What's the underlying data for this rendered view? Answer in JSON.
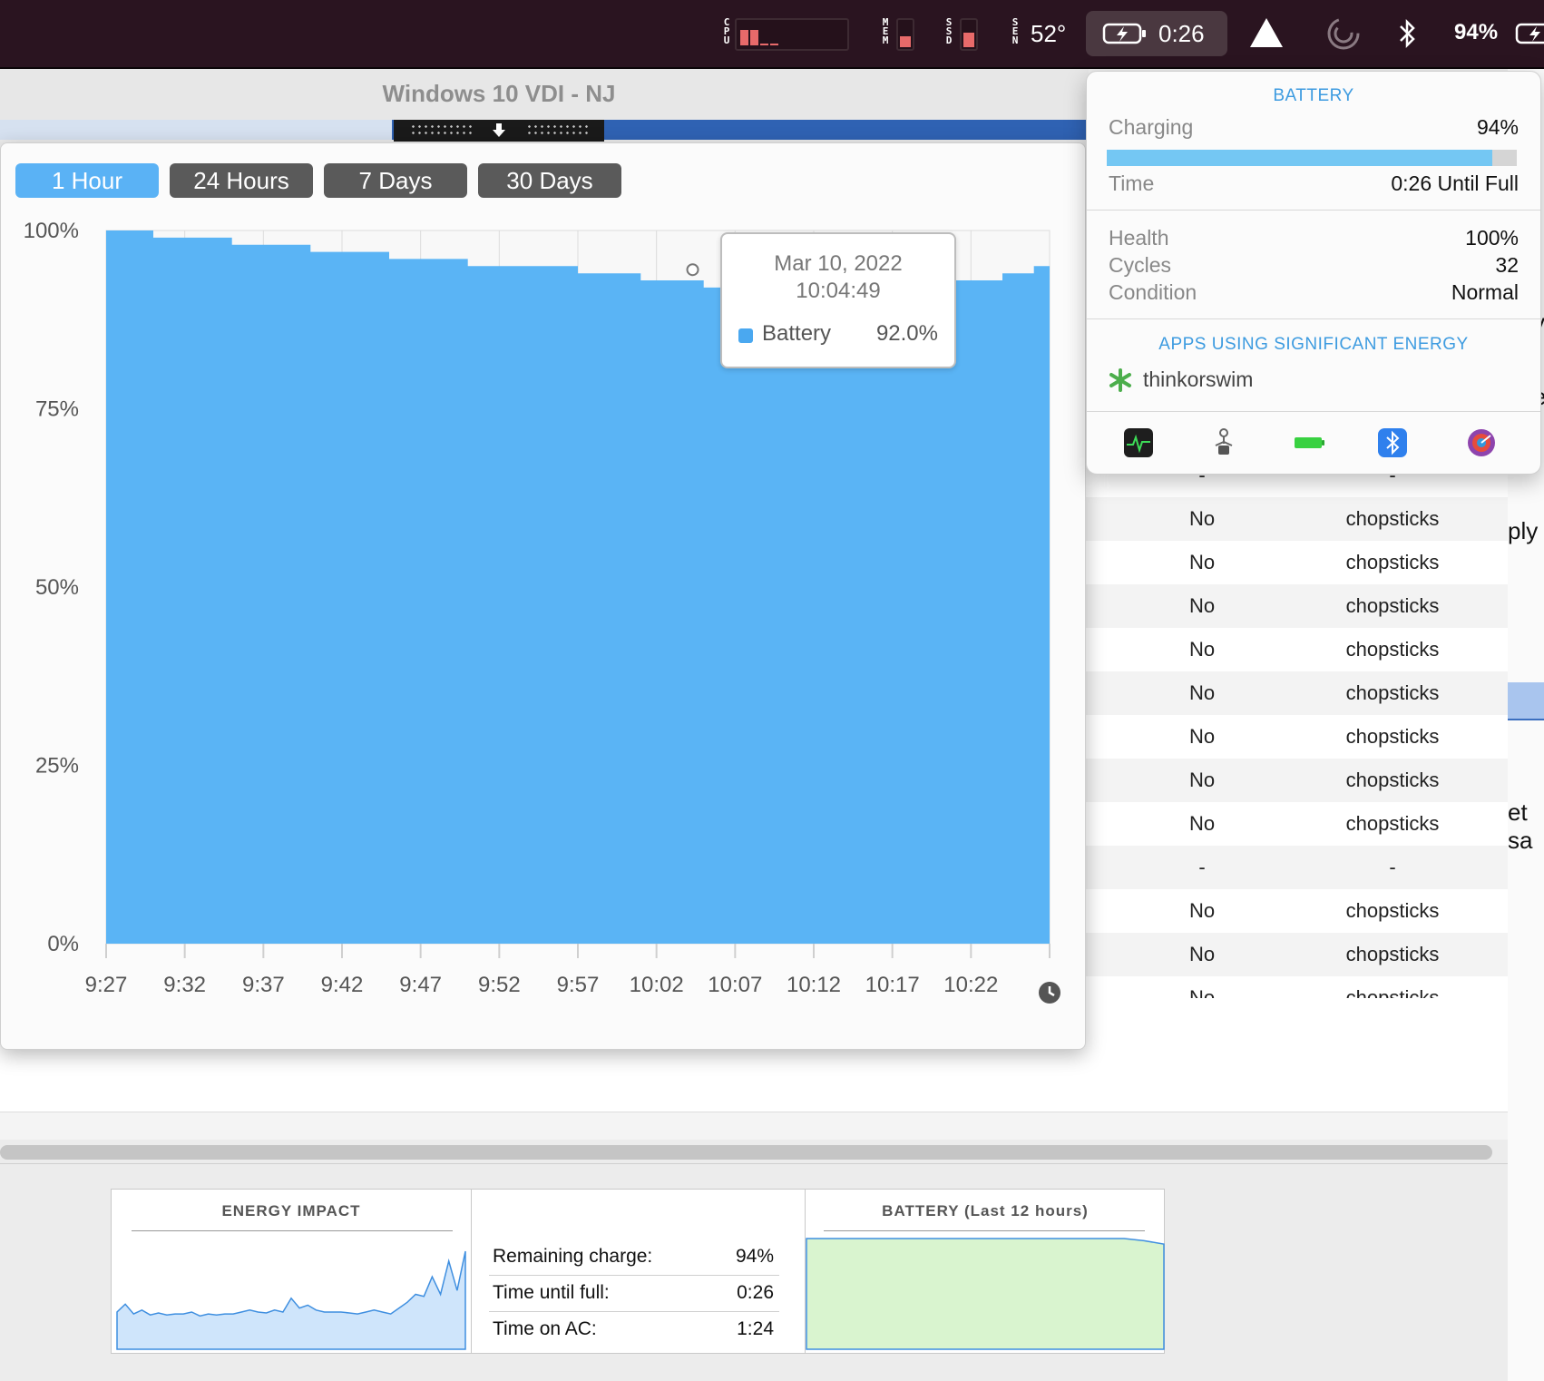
{
  "menubar": {
    "cpu_label": "CPU",
    "mem_label": "MEM",
    "ssd_label": "SSD",
    "sen_label": "SEN",
    "temperature": "52°",
    "battery_time": "0:26",
    "battery_percent": "94%",
    "cpu_bars_percent": [
      70,
      70,
      10,
      10
    ],
    "mem_fill_percent": 45,
    "ssd_fill_percent": 60,
    "icons": [
      "cpu-graph-icon",
      "battery-charging-icon",
      "warning-triangle-icon",
      "spiral-icon",
      "bluetooth-icon",
      "battery-charging-icon"
    ]
  },
  "background_window": {
    "title": "Windows 10 VDI - NJ",
    "edge_texts": [
      "ply",
      "et sa",
      "e",
      "y"
    ]
  },
  "table": {
    "rows": [
      {
        "c1": "-",
        "c2": "-"
      },
      {
        "c1": "No",
        "c2": "chopsticks"
      },
      {
        "c1": "No",
        "c2": "chopsticks"
      },
      {
        "c1": "No",
        "c2": "chopsticks"
      },
      {
        "c1": "No",
        "c2": "chopsticks"
      },
      {
        "c1": "No",
        "c2": "chopsticks"
      },
      {
        "c1": "No",
        "c2": "chopsticks"
      },
      {
        "c1": "No",
        "c2": "chopsticks"
      },
      {
        "c1": "No",
        "c2": "chopsticks"
      },
      {
        "c1": "-",
        "c2": "-"
      },
      {
        "c1": "No",
        "c2": "chopsticks"
      },
      {
        "c1": "No",
        "c2": "chopsticks"
      },
      {
        "c1": "No",
        "c2": "chopsticks"
      }
    ]
  },
  "battery_chart_window": {
    "tabs": [
      "1 Hour",
      "24 Hours",
      "7 Days",
      "30 Days"
    ],
    "active_tab": "1 Hour",
    "tooltip": {
      "date": "Mar 10, 2022",
      "time": "10:04:49",
      "series_label": "Battery",
      "value": "92.0%"
    }
  },
  "chart_data": {
    "type": "area",
    "x_tick_labels": [
      "9:27",
      "9:32",
      "9:37",
      "9:42",
      "9:47",
      "9:52",
      "9:57",
      "10:02",
      "10:07",
      "10:12",
      "10:17",
      "10:22"
    ],
    "y_tick_labels": [
      "100%",
      "75%",
      "50%",
      "25%",
      "0%"
    ],
    "ylim": [
      0,
      100
    ],
    "xlim": [
      0,
      60
    ],
    "series": [
      {
        "name": "Battery",
        "color": "#5ab4f5",
        "points": [
          [
            0,
            100
          ],
          [
            3,
            100
          ],
          [
            3,
            99
          ],
          [
            8,
            99
          ],
          [
            8,
            98
          ],
          [
            13,
            98
          ],
          [
            13,
            97
          ],
          [
            18,
            97
          ],
          [
            18,
            96
          ],
          [
            23,
            96
          ],
          [
            23,
            95
          ],
          [
            30,
            95
          ],
          [
            30,
            94
          ],
          [
            34,
            94
          ],
          [
            34,
            93
          ],
          [
            38,
            93
          ],
          [
            38,
            92
          ],
          [
            53,
            92
          ],
          [
            53,
            93
          ],
          [
            57,
            93
          ],
          [
            57,
            94
          ],
          [
            59,
            94
          ],
          [
            59,
            95
          ],
          [
            60,
            95
          ]
        ]
      }
    ],
    "hover_minute": 37.3,
    "grid": true
  },
  "battery_popover": {
    "title": "BATTERY",
    "charging_label": "Charging",
    "charging_value": "94%",
    "charge_fill_percent": 94,
    "time_label": "Time",
    "time_value": "0:26 Until Full",
    "health_label": "Health",
    "health_value": "100%",
    "cycles_label": "Cycles",
    "cycles_value": "32",
    "condition_label": "Condition",
    "condition_value": "Normal",
    "apps_title": "APPS USING SIGNIFICANT ENERGY",
    "app_name": "thinkorswim",
    "footer_icons": [
      "activity-monitor-icon",
      "system-info-icon",
      "battery-icon",
      "bluetooth-icon",
      "disk-utility-icon"
    ]
  },
  "activity_monitor_energy": {
    "energy_impact_title": "ENERGY IMPACT",
    "battery_graph_title": "BATTERY (Last 12 hours)",
    "remaining_charge_label": "Remaining charge:",
    "remaining_charge_value": "94%",
    "time_until_full_label": "Time until full:",
    "time_until_full_value": "0:26",
    "time_on_ac_label": "Time on AC:",
    "time_on_ac_value": "1:24",
    "energy_impact_series": [
      38,
      46,
      36,
      40,
      35,
      37,
      35,
      36,
      36,
      38,
      34,
      36,
      35,
      36,
      36,
      38,
      40,
      38,
      37,
      40,
      38,
      52,
      42,
      45,
      40,
      38,
      38,
      38,
      37,
      36,
      38,
      40,
      38,
      36,
      42,
      48,
      56,
      54,
      74,
      56,
      90,
      60,
      100
    ],
    "battery_12h_series": [
      100,
      100,
      100,
      100,
      100,
      100,
      100,
      100,
      100,
      100,
      100,
      100,
      100,
      100,
      100,
      100,
      100,
      98,
      95
    ]
  }
}
